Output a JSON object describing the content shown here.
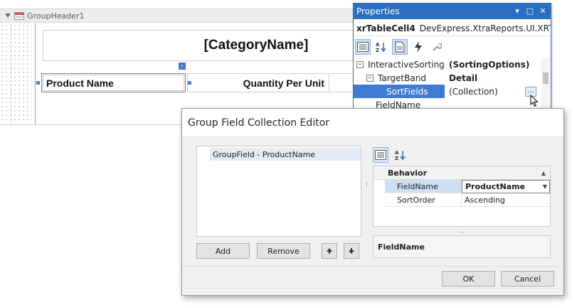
{
  "designer": {
    "band_name": "GroupHeader1",
    "category_field": "[CategoryName]",
    "table_cells": [
      "Product Name",
      "Quantity Per Unit"
    ]
  },
  "properties": {
    "title": "Properties",
    "object_name": "xrTableCell4",
    "object_type": "DevExpress.XtraReports.UI.XRTable",
    "rows": [
      {
        "name": "InteractiveSorting",
        "value": "(SortingOptions)",
        "expandable": true
      },
      {
        "name": "TargetBand",
        "value": "Detail",
        "expandable": true
      },
      {
        "name": "SortFields",
        "value": "(Collection)",
        "selected": true
      },
      {
        "name": "FieldName",
        "value": ""
      }
    ],
    "ellipsis_label": "..."
  },
  "dialog": {
    "title": "Group Field Collection Editor",
    "list_items": [
      "GroupField - ProductName"
    ],
    "buttons": {
      "add": "Add",
      "remove": "Remove",
      "ok": "OK",
      "cancel": "Cancel"
    },
    "grid": {
      "category": "Behavior",
      "rows": [
        {
          "name": "FieldName",
          "value": "ProductName",
          "selected": true
        },
        {
          "name": "SortOrder",
          "value": "Ascending"
        }
      ]
    },
    "description_title": "FieldName"
  }
}
